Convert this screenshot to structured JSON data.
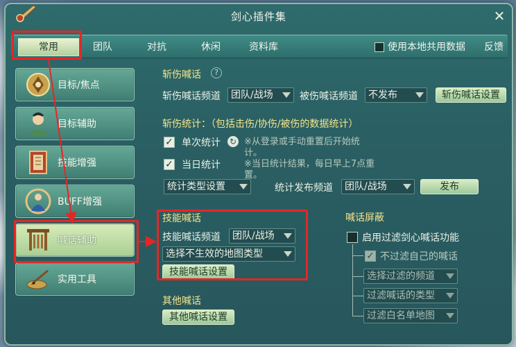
{
  "window": {
    "title": "剑心插件集"
  },
  "tabs": [
    {
      "label": "常用",
      "active": true
    },
    {
      "label": "团队"
    },
    {
      "label": "对抗"
    },
    {
      "label": "休闲"
    },
    {
      "label": "资料库"
    }
  ],
  "header": {
    "share_label": "使用本地共用数据",
    "feedback_label": "反馈"
  },
  "sidebar": {
    "items": [
      {
        "label": "目标/焦点",
        "icon": "target-icon"
      },
      {
        "label": "目标辅助",
        "icon": "character-icon"
      },
      {
        "label": "技能增强",
        "icon": "scroll-book-icon"
      },
      {
        "label": "BUFF增强",
        "icon": "buff-figure-icon"
      },
      {
        "label": "喊话辅助",
        "icon": "gate-icon",
        "active": true
      },
      {
        "label": "实用工具",
        "icon": "brush-inkstone-icon"
      }
    ]
  },
  "slash_shout": {
    "title": "斩伤喊话",
    "channel_label": "斩伤喊话频道",
    "channel_value": "团队/战场",
    "wounded_label": "被伤喊话频道",
    "wounded_value": "不发布",
    "settings_button": "斩伤喊话设置"
  },
  "slash_stats": {
    "title": "斩伤统计：（包括击伤/协伤/被伤的数据统计）",
    "single_label": "单次统计",
    "single_checked": true,
    "single_note": "※从登录或手动重置后开始统计。",
    "daily_label": "当日统计",
    "daily_checked": true,
    "daily_note": "※当日统计结果，每日早上7点重置。",
    "type_settings": "统计类型设置",
    "publish_channel_label": "统计发布频道",
    "publish_channel_value": "团队/战场",
    "publish_button": "发布"
  },
  "skill_shout": {
    "title": "技能喊话",
    "channel_label": "技能喊话频道",
    "channel_value": "团队/战场",
    "map_select": "选择不生效的地图类型",
    "settings_button": "技能喊话设置"
  },
  "other_shout": {
    "title": "其他喊话",
    "settings_button": "其他喊话设置"
  },
  "shout_filter": {
    "title": "喊话屏蔽",
    "enable_label": "启用过滤剑心喊话功能",
    "enable_checked": false,
    "no_self_label": "不过滤自己的喊话",
    "no_self_checked": true,
    "select_channel": "选择过滤的频道",
    "filter_type": "过滤喊话的类型",
    "whitelist_map": "过滤白名单地图"
  },
  "colors": {
    "highlight_red": "#e52626",
    "section_title": "#f6e58a",
    "panel_bg": "#2a5f63"
  }
}
